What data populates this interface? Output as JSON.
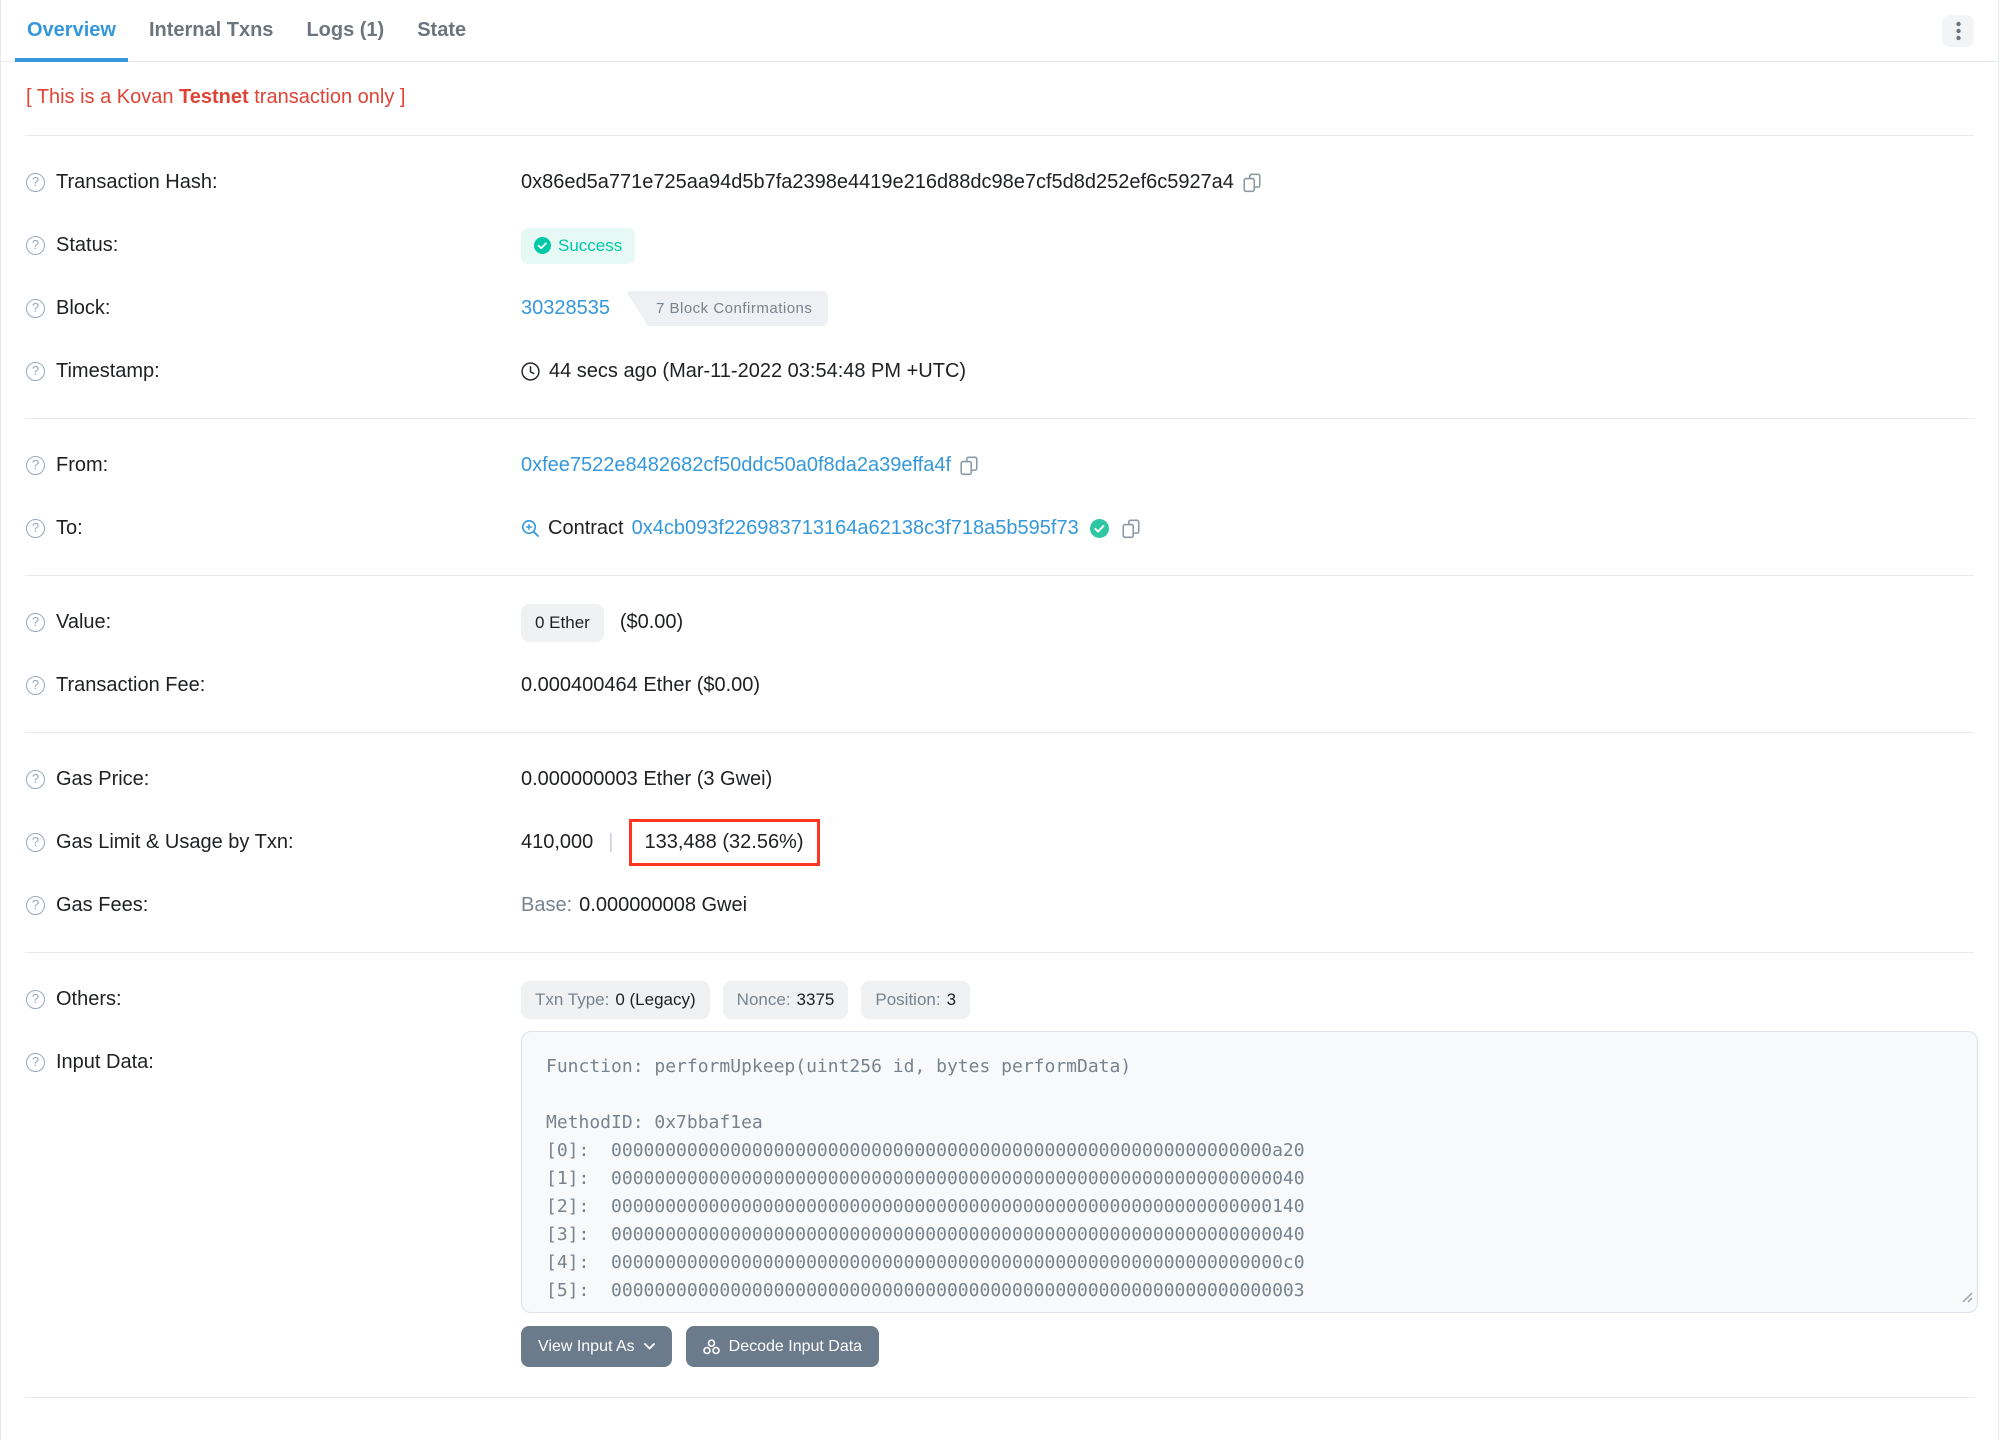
{
  "tabs": [
    {
      "label": "Overview",
      "active": true
    },
    {
      "label": "Internal Txns",
      "active": false
    },
    {
      "label": "Logs (1)",
      "active": false
    },
    {
      "label": "State",
      "active": false
    }
  ],
  "warning": {
    "prefix": "[ This is a Kovan ",
    "bold": "Testnet",
    "suffix": " transaction only ]"
  },
  "rows": {
    "transaction_hash": {
      "label": "Transaction Hash:",
      "value": "0x86ed5a771e725aa94d5b7fa2398e4419e216d88dc98e7cf5d8d252ef6c5927a4"
    },
    "status": {
      "label": "Status:",
      "value": "Success"
    },
    "block": {
      "label": "Block:",
      "number": "30328535",
      "confirmations": "7 Block Confirmations"
    },
    "timestamp": {
      "label": "Timestamp:",
      "value": "44 secs ago (Mar-11-2022 03:54:48 PM +UTC)"
    },
    "from": {
      "label": "From:",
      "address": "0xfee7522e8482682cf50ddc50a0f8da2a39effa4f"
    },
    "to": {
      "label": "To:",
      "kind": "Contract",
      "address": "0x4cb093f226983713164a62138c3f718a5b595f73"
    },
    "value": {
      "label": "Value:",
      "amount": "0 Ether",
      "usd": "($0.00)"
    },
    "transaction_fee": {
      "label": "Transaction Fee:",
      "value": "0.000400464 Ether ($0.00)"
    },
    "gas_price": {
      "label": "Gas Price:",
      "value": "0.000000003 Ether (3 Gwei)"
    },
    "gas_limit": {
      "label": "Gas Limit & Usage by Txn:",
      "limit": "410,000",
      "separator": "|",
      "usage": "133,488 (32.56%)"
    },
    "gas_fees": {
      "label": "Gas Fees:",
      "base_label": "Base:",
      "base_value": "0.000000008 Gwei"
    },
    "others": {
      "label": "Others:",
      "badges": [
        {
          "k": "Txn Type:",
          "v": "0 (Legacy)"
        },
        {
          "k": "Nonce:",
          "v": "3375"
        },
        {
          "k": "Position:",
          "v": "3"
        }
      ]
    },
    "input_data": {
      "label": "Input Data:"
    }
  },
  "input_data": {
    "lines": [
      "Function: performUpkeep(uint256 id, bytes performData)",
      "",
      "MethodID: 0x7bbaf1ea",
      "[0]:  0000000000000000000000000000000000000000000000000000000000000a20",
      "[1]:  0000000000000000000000000000000000000000000000000000000000000040",
      "[2]:  0000000000000000000000000000000000000000000000000000000000000140",
      "[3]:  0000000000000000000000000000000000000000000000000000000000000040",
      "[4]:  00000000000000000000000000000000000000000000000000000000000000c0",
      "[5]:  0000000000000000000000000000000000000000000000000000000000000003"
    ]
  },
  "buttons": {
    "view_input_as": "View Input As",
    "decode": "Decode Input Data"
  },
  "colors": {
    "accent_blue": "#3498db",
    "success_teal": "#00c9a7",
    "danger_red": "#de4437",
    "muted_gray": "#77838f",
    "highlight_red": "#ff3522",
    "divider": "#e7eaf3"
  }
}
